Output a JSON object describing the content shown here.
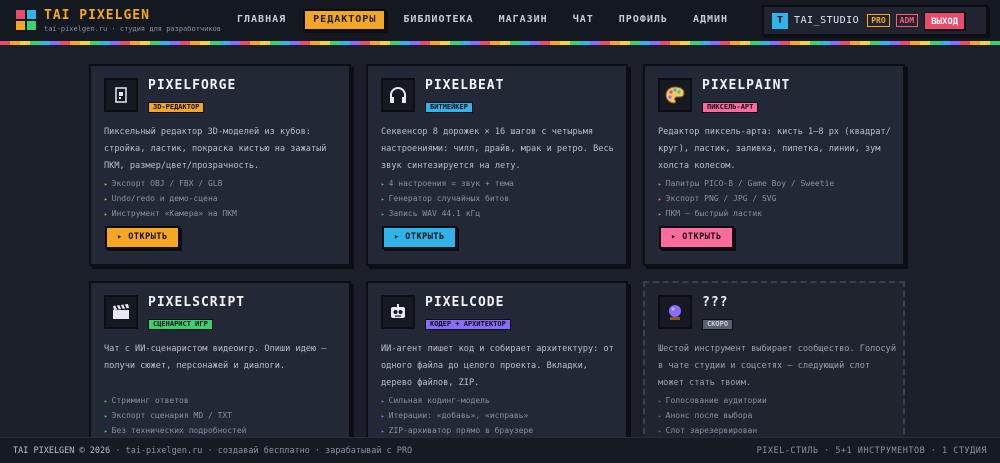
{
  "header": {
    "logo_title": "TAI PIXELGEN",
    "logo_sub": "tai-pixelgen.ru · студия для разработчиков",
    "logo_colors": [
      "#e94b6b",
      "#2fb3e8",
      "#f5a623",
      "#3bd16f"
    ],
    "nav": [
      {
        "label": "ГЛАВНАЯ",
        "active": false
      },
      {
        "label": "РЕДАКТОРЫ",
        "active": true
      },
      {
        "label": "БИБЛИОТЕКА",
        "active": false
      },
      {
        "label": "МАГАЗИН",
        "active": false
      },
      {
        "label": "ЧАТ",
        "active": false
      },
      {
        "label": "ПРОФИЛЬ",
        "active": false
      },
      {
        "label": "АДМИН",
        "active": false
      }
    ],
    "user": {
      "avatar_letter": "T",
      "name": "TAI_STUDIO",
      "badge_pro": "PRO",
      "badge_adm": "ADM",
      "logout_label": "ВЫХОД"
    }
  },
  "cards": [
    {
      "title": "PIXELFORGE",
      "tag": "3D-РЕДАКТОР",
      "tag_color": "#f5a623",
      "icon": "cube-icon",
      "desc": "Пиксельный редактор 3D-моделей из кубов: стройка, ластик, покраска кистью на зажатый ПКМ, размер/цвет/прозрачность.",
      "features": [
        "Экспорт OBJ / FBX / GLB",
        "Undo/redo и демо-сцена",
        "Инструмент «Камера» на ПКМ"
      ],
      "button": "▸ ОТКРЫТЬ",
      "button_color": "#f5a623"
    },
    {
      "title": "PIXELBEAT",
      "tag": "БИТМЕЙКЕР",
      "tag_color": "#2fb3e8",
      "icon": "headphones-icon",
      "desc": "Секвенсор 8 дорожек × 16 шагов с четырьмя настроениями: чилл, драйв, мрак и ретро. Весь звук синтезируется на лету.",
      "features": [
        "4 настроения = звук + тема",
        "Генератор случайных битов",
        "Запись WAV 44.1 кГц"
      ],
      "button": "▸ ОТКРЫТЬ",
      "button_color": "#2fb3e8"
    },
    {
      "title": "PIXELPAINT",
      "tag": "ПИКСЕЛЬ-АРТ",
      "tag_color": "#ff6b9a",
      "icon": "palette-icon",
      "desc": "Редактор пиксель-арта: кисть 1–8 px (квадрат/круг), ластик, заливка, пипетка, линии, зум холста колесом.",
      "features": [
        "Палитры PICO-8 / Game Boy / Sweetie",
        "Экспорт PNG / JPG / SVG",
        "ПКМ — быстрый ластик"
      ],
      "button": "▸ ОТКРЫТЬ",
      "button_color": "#ff6b9a"
    },
    {
      "title": "PIXELSCRIPT",
      "tag": "СЦЕНАРИСТ ИГР",
      "tag_color": "#3bd16f",
      "icon": "clapperboard-icon",
      "desc": "Чат с ИИ-сценаристом видеоигр. Опиши идею — получи сюжет, персонажей и диалоги.",
      "features": [
        "Стриминг ответов",
        "Экспорт сценария MD / TXT",
        "Без технических подробностей"
      ],
      "button": "",
      "button_color": "#3bd16f"
    },
    {
      "title": "PIXELCODE",
      "tag": "КОДЕР + АРХИТЕКТОР",
      "tag_color": "#8a6cff",
      "icon": "robot-icon",
      "desc": "ИИ-агент пишет код и собирает архитектуру: от одного файла до целого проекта. Вкладки, дерево файлов, ZIP.",
      "features": [
        "Сильная кодинг-модель",
        "Итерации: «добавь», «исправь»",
        "ZIP-архиватор прямо в браузере"
      ],
      "button": "",
      "button_color": "#8a6cff"
    },
    {
      "title": "???",
      "tag": "СКОРО",
      "tag_color": "#5a6070",
      "icon": "crystal-ball-icon",
      "desc": "Шестой инструмент выбирает сообщество. Голосуй в чате студии и соцсетях — следующий слот может стать твоим.",
      "features": [
        "Голосование аудитории",
        "Анонс после выбора",
        "Слот зарезервирован"
      ],
      "button": "",
      "button_color": "#5a6070"
    }
  ],
  "footer": {
    "left_brand": "TAI PIXELGEN © 2026",
    "left_rest": " · tai-pixelgen.ru · создавай бесплатно · зарабатывай с PRO",
    "right": "PIXEL-СТИЛЬ · 5+1 ИНСТРУМЕНТОВ · 1 СТУДИЯ"
  }
}
